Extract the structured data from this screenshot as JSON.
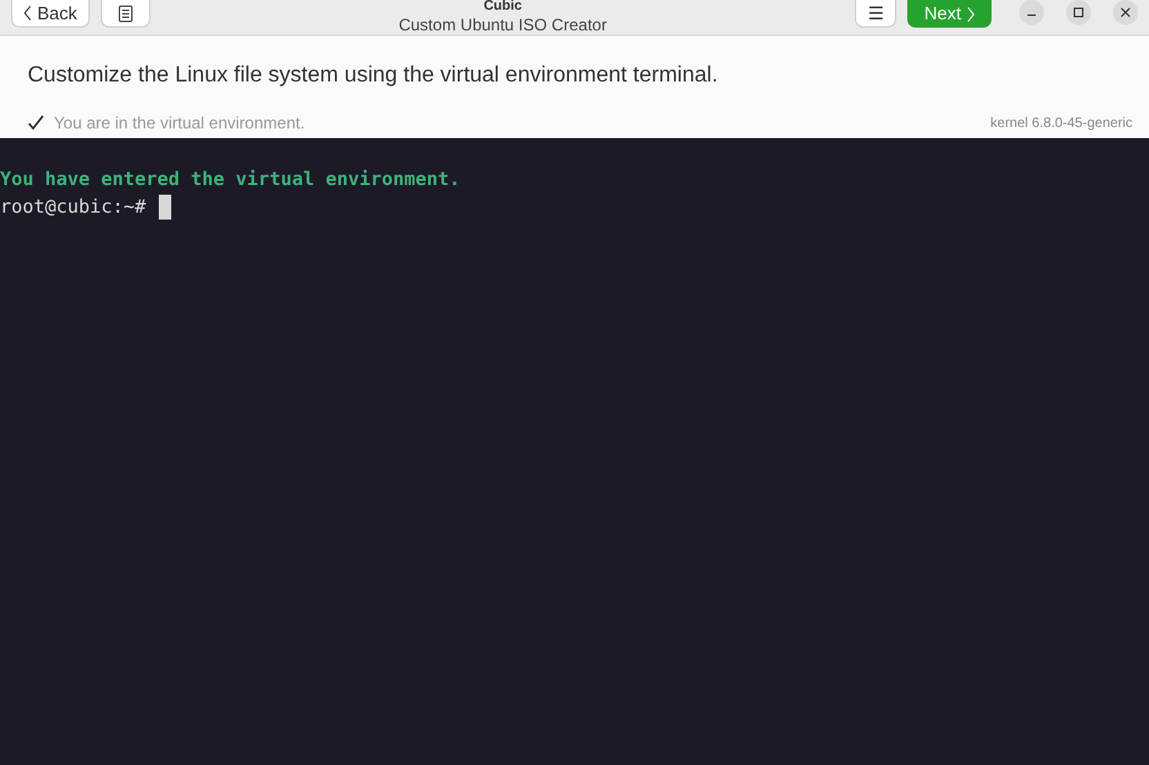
{
  "header": {
    "back": "Back",
    "title": "Cubic",
    "subtitle": "Custom Ubuntu ISO Creator",
    "menu": "☰",
    "next": "Next"
  },
  "instruction": "Customize the Linux file system using the virtual environment terminal.",
  "status": {
    "checked": true,
    "text": "You are in the virtual environment.",
    "kernel": "kernel 6.8.0-45-generic"
  },
  "terminal": {
    "lines": [
      {
        "kind": "notice",
        "text": "You have entered the virtual environment."
      },
      {
        "kind": "prompt",
        "text": "root@cubic:~#"
      }
    ]
  }
}
